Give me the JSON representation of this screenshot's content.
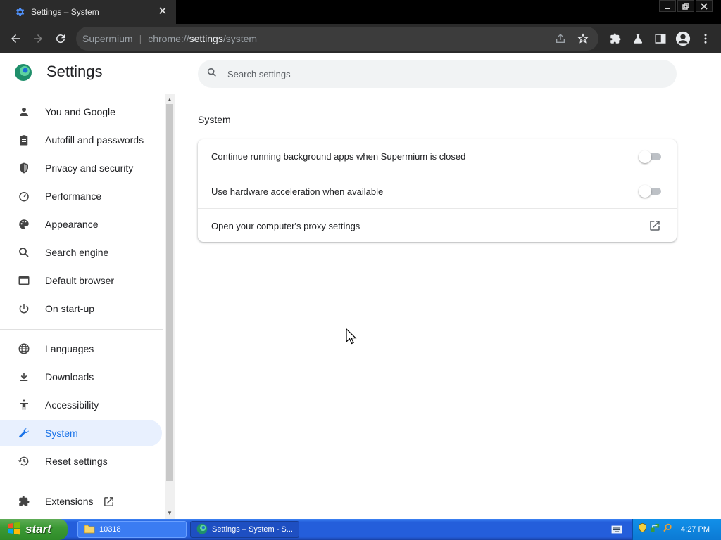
{
  "window": {
    "tab_title": "Settings – System",
    "tab_close": "✕"
  },
  "omnibox": {
    "brand": "Supermium",
    "separator": "|",
    "url_scheme": "chrome://",
    "url_host": "settings",
    "url_path": "/system"
  },
  "header": {
    "title": "Settings",
    "search_placeholder": "Search settings"
  },
  "sidebar": {
    "items": [
      {
        "label": "You and Google",
        "icon": "person-icon"
      },
      {
        "label": "Autofill and passwords",
        "icon": "clipboard-icon"
      },
      {
        "label": "Privacy and security",
        "icon": "shield-icon"
      },
      {
        "label": "Performance",
        "icon": "speedometer-icon"
      },
      {
        "label": "Appearance",
        "icon": "palette-icon"
      },
      {
        "label": "Search engine",
        "icon": "search-icon"
      },
      {
        "label": "Default browser",
        "icon": "browser-icon"
      },
      {
        "label": "On start-up",
        "icon": "power-icon"
      },
      {
        "label": "Languages",
        "icon": "globe-icon"
      },
      {
        "label": "Downloads",
        "icon": "download-icon"
      },
      {
        "label": "Accessibility",
        "icon": "accessibility-icon"
      },
      {
        "label": "System",
        "icon": "wrench-icon",
        "active": true
      },
      {
        "label": "Reset settings",
        "icon": "history-icon"
      },
      {
        "label": "Extensions",
        "icon": "puzzle-icon"
      }
    ]
  },
  "main": {
    "section_title": "System",
    "rows": [
      {
        "label": "Continue running background apps when Supermium is closed",
        "control": "toggle",
        "on": false
      },
      {
        "label": "Use hardware acceleration when available",
        "control": "toggle",
        "on": false
      },
      {
        "label": "Open your computer's proxy settings",
        "control": "external-link"
      }
    ]
  },
  "taskbar": {
    "start_label": "start",
    "tasks": [
      {
        "label": "10318",
        "icon": "folder-icon"
      },
      {
        "label": "Settings – System - S...",
        "icon": "browser-logo-icon"
      }
    ],
    "clock": "4:27 PM"
  },
  "colors": {
    "accent": "#1a73e8",
    "active_nav_bg": "#e8f0fe",
    "toolbar_bg": "#2b2b2b",
    "taskbar_blue": "#245edb",
    "start_green": "#3c9a35"
  }
}
